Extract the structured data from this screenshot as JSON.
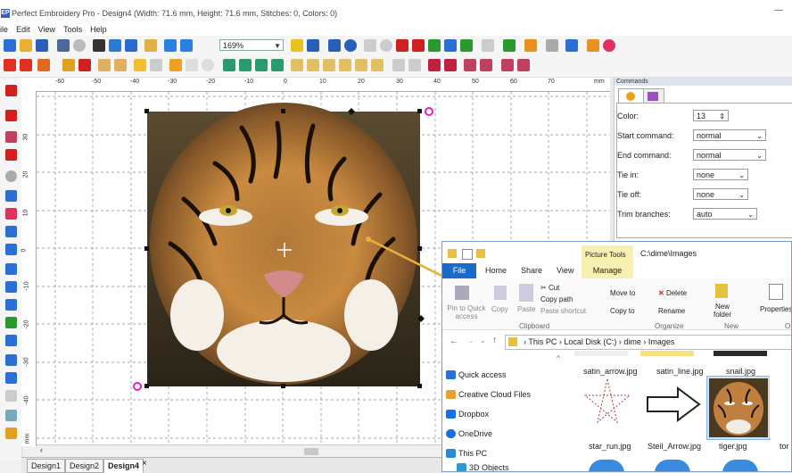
{
  "window": {
    "title": "Perfect Embroidery Pro - Design4 (Width: 71.6 mm, Height: 71.6 mm, Stitches: 0, Colors: 0)",
    "app_icon": "EP",
    "minimize": "—"
  },
  "menu": [
    "ile",
    "Edit",
    "View",
    "Tools",
    "Help"
  ],
  "toolbar": {
    "zoom": "169%"
  },
  "ruler": {
    "h_ticks": [
      "-60",
      "-50",
      "-40",
      "-30",
      "-20",
      "-10",
      "0",
      "10",
      "20",
      "30",
      "40",
      "50",
      "60",
      "70"
    ],
    "unit": "mm",
    "v_ticks": [
      "30",
      "20",
      "10",
      "0",
      "-10",
      "-20",
      "-30",
      "-40"
    ],
    "v_unit": "mm"
  },
  "tabs": [
    "Design1",
    "Design2",
    "Design4"
  ],
  "tab_close": "×",
  "commands": {
    "header": "Commands",
    "rows": [
      {
        "label": "Color:",
        "value": "13"
      },
      {
        "label": "Start command:",
        "value": "normal"
      },
      {
        "label": "End command:",
        "value": "normal"
      },
      {
        "label": "Tie in:",
        "value": "none"
      },
      {
        "label": "Tie off:",
        "value": "none"
      },
      {
        "label": "Trim branches:",
        "value": "auto"
      }
    ]
  },
  "explorer": {
    "context_tab": "Picture Tools",
    "path": "C:\\dime\\Images",
    "ribbon_tabs": [
      "File",
      "Home",
      "Share",
      "View",
      "Manage"
    ],
    "ribbon_items": {
      "pin": "Pin to Quick access",
      "copy": "Copy",
      "paste": "Paste",
      "cut": "Cut",
      "copy_path": "Copy path",
      "paste_shortcut": "Paste shortcut",
      "move_to": "Move to",
      "delete": "Delete",
      "copy_to": "Copy to",
      "rename": "Rename",
      "new_folder": "New folder",
      "properties": "Properties"
    },
    "groups": [
      "Clipboard",
      "Organize",
      "New",
      "O"
    ],
    "breadcrumb": [
      "This PC",
      "Local Disk (C:)",
      "dime",
      "Images"
    ],
    "nav": [
      "Quick access",
      "Creative Cloud Files",
      "Dropbox",
      "OneDrive",
      "This PC",
      "3D Objects"
    ],
    "files": [
      "satin_arrow.jpg",
      "satin_line.jpg",
      "snail.jpg",
      "star_run.jpg",
      "Steil_Arrow.jpg",
      "tiger.jpg",
      "tor"
    ]
  }
}
